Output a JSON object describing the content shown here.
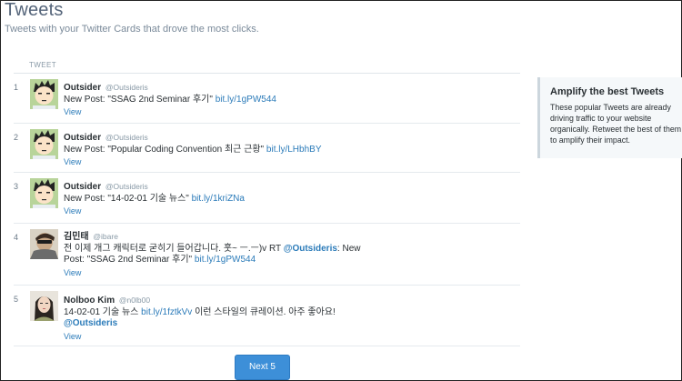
{
  "page": {
    "title": "Tweets",
    "subtitle": "Tweets with your Twitter Cards that drove the most clicks."
  },
  "table": {
    "column_header": "TWEET",
    "rows": [
      {
        "number": "1",
        "avatar": "cartoon-face-avatar",
        "name": "Outsider",
        "handle": "@Outsideris",
        "text": "New Post: \"SSAG 2nd Seminar 후기\"",
        "link": "bit.ly/1gPW544",
        "view": "View"
      },
      {
        "number": "2",
        "avatar": "cartoon-face-avatar",
        "name": "Outsider",
        "handle": "@Outsideris",
        "text": "New Post: \"Popular Coding Convention 최근 근황\"",
        "link": "bit.ly/LHbhBY",
        "view": "View"
      },
      {
        "number": "3",
        "avatar": "cartoon-face-avatar",
        "name": "Outsider",
        "handle": "@Outsideris",
        "text": "New Post: \"14-02-01 기술 뉴스\"",
        "link": "bit.ly/1kriZNa",
        "view": "View"
      },
      {
        "number": "4",
        "avatar": "photo-avatar",
        "name": "김민태",
        "handle": "@ibare",
        "text_before": "전 이제 개그 캐릭터로 굳히기 들어갑니다. 훗~ ㅡ.ㅡ)v RT",
        "mention": "@Outsideris",
        "text_after": ": New Post: \"SSAG 2nd Seminar 후기\"",
        "link": "bit.ly/1gPW544",
        "view": "View"
      },
      {
        "number": "5",
        "avatar": "portrait-avatar",
        "name": "Nolboo Kim",
        "handle": "@n0lb00",
        "text_before": "14-02-01 기술 뉴스",
        "link": "bit.ly/1fztkVv",
        "text_after": "이런 스타일의 큐레이션. 아주 좋아요!",
        "mention": "@Outsideris",
        "view": "View"
      }
    ]
  },
  "sidebar": {
    "title": "Amplify the best Tweets",
    "body": "These popular Tweets are already driving traffic to your website organically. Retweet the best of them to amplify their impact."
  },
  "pagination": {
    "next_label": "Next 5"
  },
  "colors": {
    "link": "#2b7bb9",
    "button": "#3d8fd8",
    "title": "#55657a"
  }
}
